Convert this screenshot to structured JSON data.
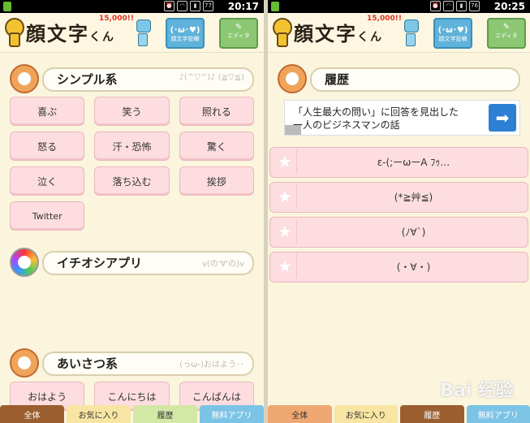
{
  "left": {
    "status": {
      "time": "20:17",
      "battery": "77"
    },
    "header": {
      "title": "顔文字",
      "title_suffix": "くん",
      "count": "15,000!!",
      "kb_label": "顔文字投稿",
      "kb_glyph": "(･ω･♥)",
      "editor_label": "エディタ"
    },
    "sections": [
      {
        "label": "シンプル系",
        "deco": "♪(^▽^)♪ (≧▽≦)"
      },
      {
        "label": "イチオシアプリ",
        "deco": "v(の'∀'の)v"
      },
      {
        "label": "あいさつ系",
        "deco": "(っω-)おはよう･･"
      }
    ],
    "simple_buttons": [
      "喜ぶ",
      "笑う",
      "照れる",
      "怒る",
      "汗・恐怖",
      "驚く",
      "泣く",
      "落ち込む",
      "挨拶",
      "Twitter"
    ],
    "greeting_buttons": [
      "おはよう",
      "こんにちは",
      "こんばんは"
    ],
    "tabs": [
      "全体",
      "お気に入り",
      "履歴",
      "無料アプリ"
    ]
  },
  "right": {
    "status": {
      "time": "20:25",
      "battery": "76"
    },
    "header": {
      "title": "顔文字",
      "title_suffix": "くん",
      "count": "15,000!!",
      "kb_label": "顔文字投稿",
      "kb_glyph": "(･ω･♥)",
      "editor_label": "エディタ"
    },
    "section": {
      "label": "履歴"
    },
    "ad": {
      "line1": "「人生最大の問い」に回答を見出した",
      "line2": "一人のビジネスマンの話",
      "arrow": "➡"
    },
    "history": [
      "ε-(;ーωーA ﾌｩ…",
      "(*≧艸≦)",
      "(ﾉ∀`)",
      "(・∀・)"
    ],
    "tabs": [
      "全体",
      "お気に入り",
      "履歴",
      "無料アプリ"
    ]
  },
  "watermark": "Bai 经验",
  "colors": {
    "pink_button": "#fddde0",
    "background": "#fbf5de",
    "tab_active": "#9b5f2f"
  }
}
